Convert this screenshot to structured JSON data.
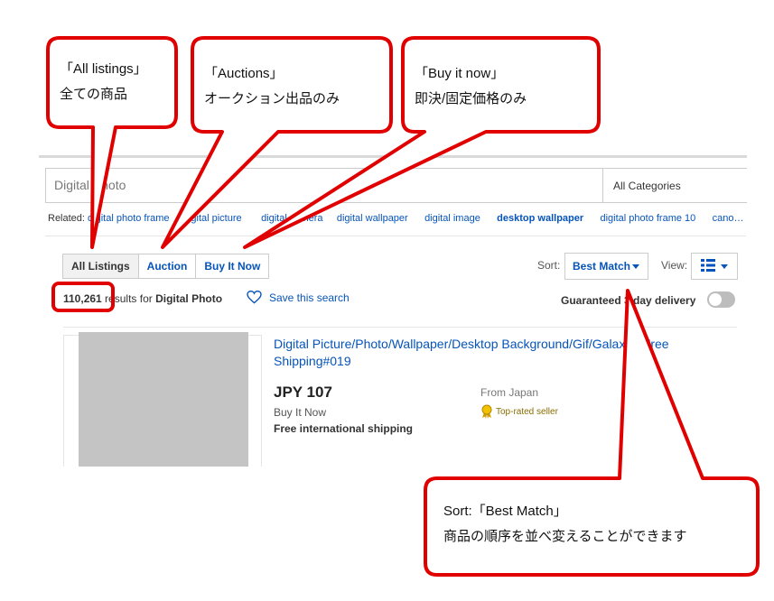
{
  "search": {
    "query": "Digital Photo",
    "category": "All Categories"
  },
  "related": {
    "label": "Related:",
    "items": [
      "digital photo frame",
      "digital picture",
      "digital camera",
      "digital wallpaper",
      "digital image",
      "desktop wallpaper",
      "digital photo frame 10",
      "cano…"
    ]
  },
  "tabs": [
    "All Listings",
    "Auction",
    "Buy It Now"
  ],
  "sort": {
    "label": "Sort:",
    "value": "Best Match"
  },
  "view": {
    "label": "View:"
  },
  "results": {
    "count": "110,261",
    "text": " results for ",
    "query": "Digital Photo",
    "save": "Save this search",
    "guaranteed": "Guaranteed 3 day delivery"
  },
  "listing": {
    "title": "Digital Picture/Photo/Wallpaper/Desktop Background/Gif/Galaxy - Free Shipping#019",
    "price": "JPY 107",
    "format": "Buy It Now",
    "shipping": "Free international shipping",
    "from": "From Japan",
    "badge": "Top-rated seller"
  },
  "callouts": {
    "all": {
      "line1": "「All listings」",
      "line2": "全ての商品"
    },
    "auctions": {
      "line1": "「Auctions」",
      "line2": "オークション出品のみ"
    },
    "buy": {
      "line1": "「Buy it now」",
      "line2": "即決/固定価格のみ"
    },
    "sort": {
      "line1": "Sort:「Best Match」",
      "line2": "商品の順序を並べ変えることができます"
    }
  },
  "colors": {
    "callout_border": "#e00000",
    "link": "#0654ba"
  }
}
